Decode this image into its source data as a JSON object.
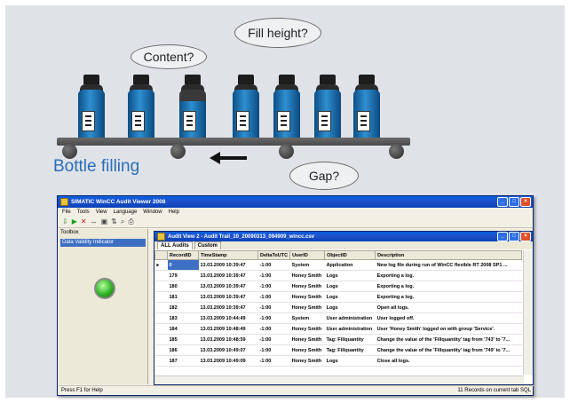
{
  "diagram": {
    "bubbles": {
      "fill_height": "Fill height?",
      "content": "Content?",
      "gap": "Gap?"
    },
    "caption": "Bottle filling",
    "colors": {
      "caption": "#2a6db6",
      "liquid": "#1f74b8",
      "background": "#dfe3e8"
    }
  },
  "app": {
    "title": "SIMATIC WinCC Audit Viewer 2008",
    "window_buttons": [
      "_",
      "□",
      "×"
    ],
    "menu": [
      "File",
      "Tools",
      "View",
      "Language",
      "Window",
      "Help"
    ],
    "toolbar_icons": [
      "open-icon",
      "play-icon",
      "stop-icon",
      "navigate-icon",
      "filter-icon",
      "sort-icon",
      "search-icon",
      "print-icon"
    ],
    "toolbox": {
      "header": "Toolbox",
      "item": "Data Validity Indicator",
      "lamp_state": "green"
    },
    "child_window": {
      "title": "Audit View 2 - Audit Trail_10_20090313_094909_wincc.csv",
      "tabs": [
        "ALL Audits",
        "Custom"
      ],
      "columns": [
        "",
        "RecordID",
        "TimeStamp",
        "DeltaToUTC",
        "UserID",
        "ObjectID",
        "Description"
      ],
      "rows": [
        [
          "▸",
          "0",
          "13.03.2009 10:39:47",
          "-1:00",
          "System",
          "Application",
          "New log file during run of WinCC flexible RT 2008 SP1 ..."
        ],
        [
          "",
          "179",
          "13.03.2009 10:39:47",
          "-1:00",
          "Honey Smith",
          "Logs",
          "Exporting a log."
        ],
        [
          "",
          "180",
          "13.03.2009 10:39:47",
          "-1:00",
          "Honey Smith",
          "Logs",
          "Exporting a log."
        ],
        [
          "",
          "181",
          "13.03.2009 10:39:47",
          "-1:00",
          "Honey Smith",
          "Logs",
          "Exporting a log."
        ],
        [
          "",
          "182",
          "13.03.2009 10:39:47",
          "-1:00",
          "Honey Smith",
          "Logs",
          "Open all logs."
        ],
        [
          "",
          "183",
          "13.03.2009 10:44:49",
          "-1:00",
          "System",
          "User administration",
          "User logged off."
        ],
        [
          "",
          "184",
          "13.03.2009 10:48:49",
          "-1:00",
          "Honey Smith",
          "User administration",
          "User 'Honey Smith' logged on with group 'Service'."
        ],
        [
          "",
          "185",
          "13.03.2009 10:48:59",
          "-1:00",
          "Honey Smith",
          "Tag: Fillquantity",
          "Change the value of the 'Fillquantity' tag from '743' to '7..."
        ],
        [
          "",
          "186",
          "13.03.2009 10:49:07",
          "-1:00",
          "Honey Smith",
          "Tag: Fillquantity",
          "Change the value of the 'Fillquantity' tag from '749' to '7..."
        ],
        [
          "",
          "187",
          "13.03.2009 10:49:09",
          "-1:00",
          "Honey Smith",
          "Logs",
          "Close all logs."
        ]
      ]
    },
    "status": {
      "left": "Press F1 for Help",
      "right": "11 Records on current tab  SQL"
    }
  }
}
